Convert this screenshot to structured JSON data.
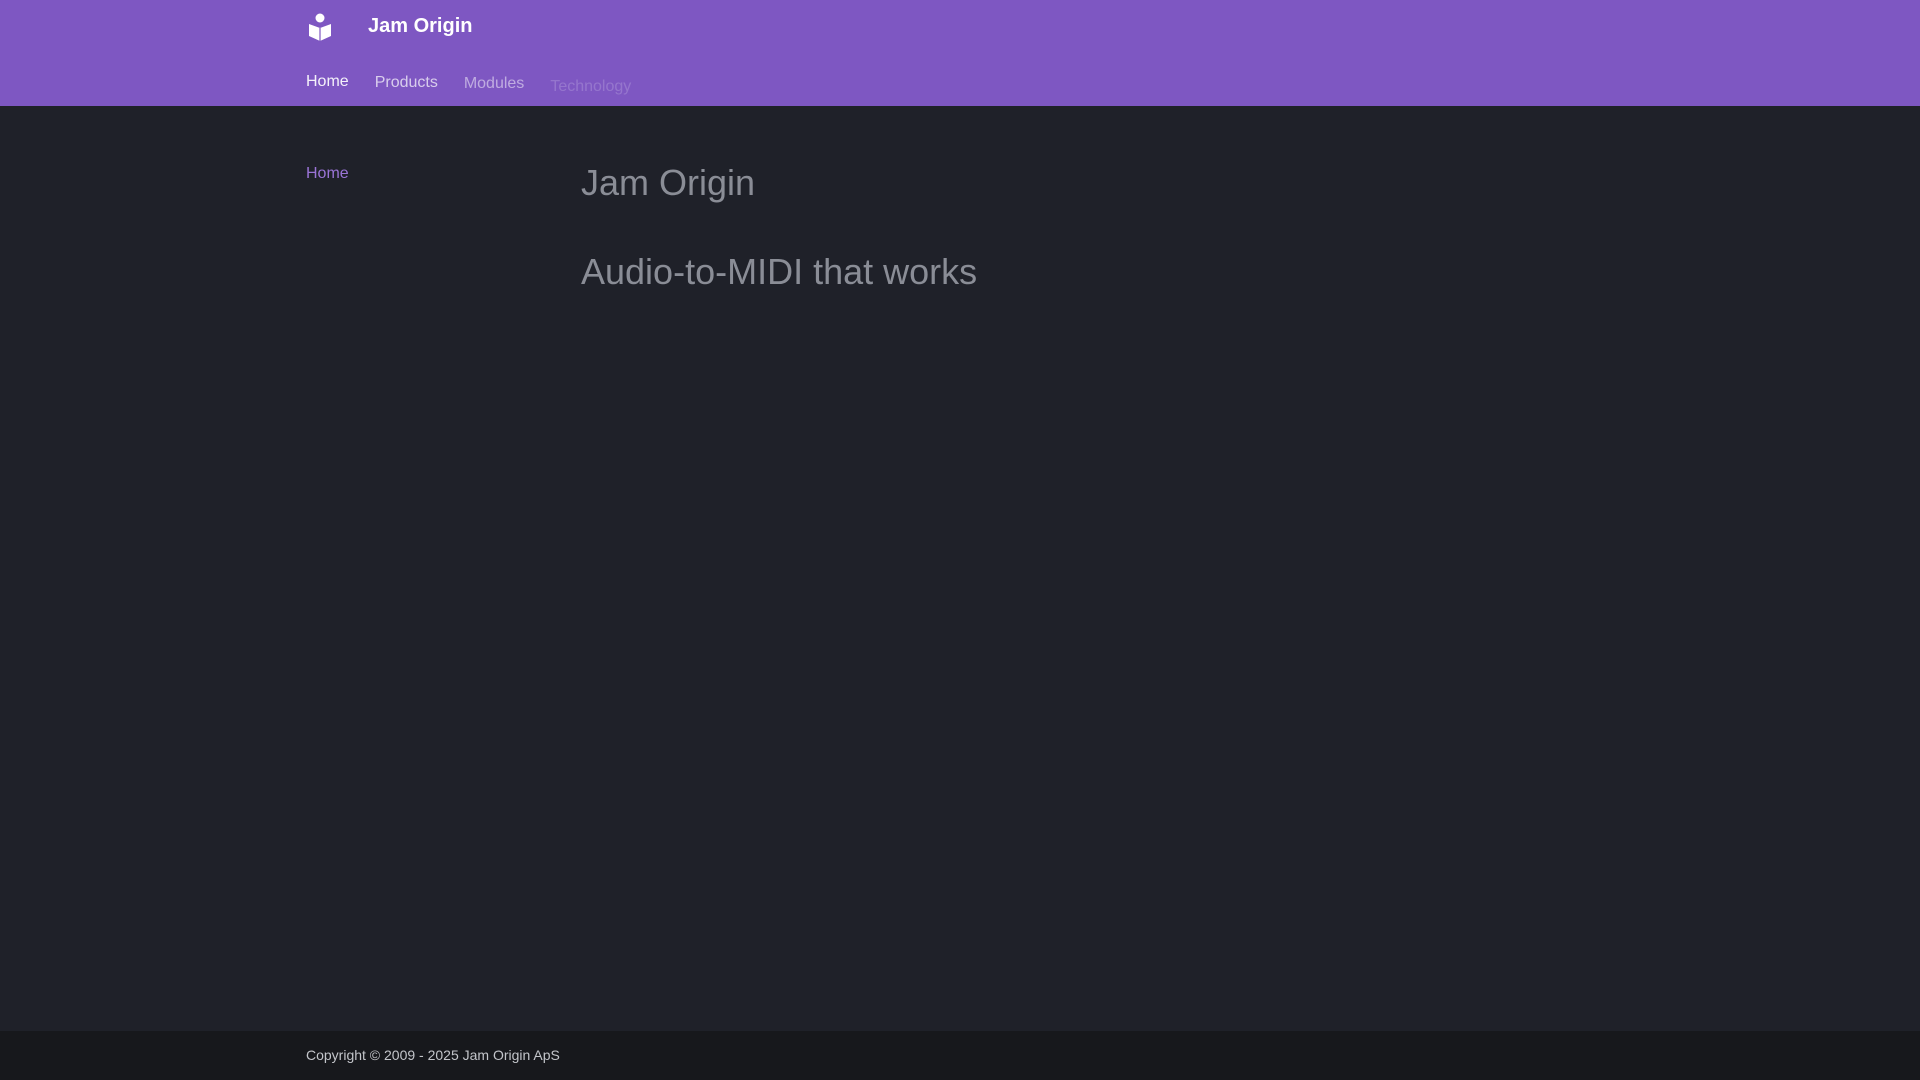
{
  "header": {
    "site_title": "Jam Origin",
    "logo_icon": "reader-book-icon",
    "tabs": [
      {
        "label": "Home"
      },
      {
        "label": "Products"
      },
      {
        "label": "Modules"
      },
      {
        "label": "Technology"
      }
    ]
  },
  "sidebar": {
    "items": [
      {
        "label": "Home"
      }
    ]
  },
  "main": {
    "title": "Jam Origin",
    "tagline": "Audio-to-MIDI that works"
  },
  "footer": {
    "copyright": "Copyright © 2009 - 2025 Jam Origin ApS"
  },
  "colors": {
    "header_bg": "#7e57c2",
    "body_bg": "#1f2129",
    "footer_bg": "#17181c",
    "accent": "#9a74d6"
  }
}
